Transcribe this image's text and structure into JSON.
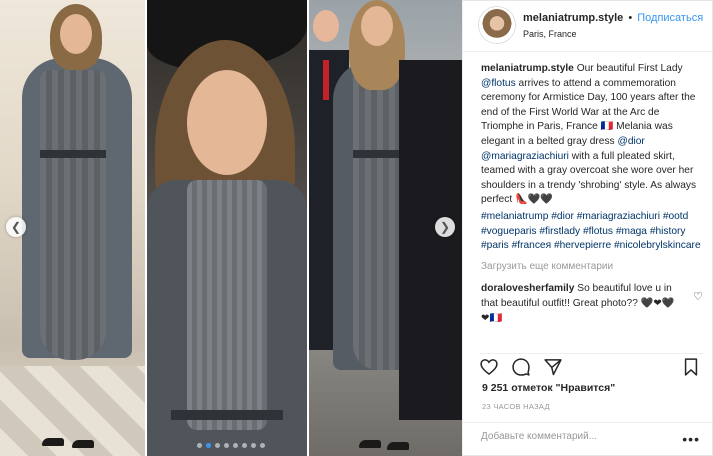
{
  "header": {
    "username": "melaniatrump.style",
    "separator": "•",
    "follow_label": "Подписаться",
    "location": "Paris, France"
  },
  "caption": {
    "username": "melaniatrump.style",
    "text_1": " Our beautiful First Lady ",
    "mention_1": "@flotus",
    "text_2": " arrives to attend a commemoration ceremony for Armistice Day, 100 years after the end of the First World War at the Arc de Triomphe in Paris, France 🇫🇷 Melania was elegant in a belted gray dress ",
    "mention_2": "@dior",
    "text_3": " ",
    "mention_3": "@mariagraziachiuri",
    "text_4": " with a full pleated skirt, teamed with a gray overcoat she wore over her shoulders in a trendy 'shrobing' style. As always perfect 👠🖤🖤"
  },
  "hashtags": [
    "#melaniatrump",
    "#dior",
    "#mariagraziachiuri",
    "#ootd",
    "#vogueparis",
    "#firstlady",
    "#flotus",
    "#maga",
    "#history",
    "#paris",
    "#franceя",
    "#hervepierre",
    "#nicolebrylskincare"
  ],
  "load_more_label": "Загрузить еще комментарии",
  "comment": {
    "username": "doralovesherfamily",
    "text": " So beautiful love u in that beautiful outfit!! Great photo?? 🖤❤🖤❤🇫🇷"
  },
  "likes": "9 251 отметок \"Нравится\"",
  "time": "23 ЧАСОВ НАЗАД",
  "add_comment_placeholder": "Добавьте комментарий...",
  "more_label": "•••",
  "icons": [
    "heart-icon",
    "comment-icon",
    "share-icon",
    "bookmark-icon",
    "chevron-left-icon",
    "chevron-right-icon",
    "more-icon"
  ],
  "carousel": {
    "dots": 8,
    "active_dot": 1
  },
  "colors": {
    "link": "#3897f0",
    "tag": "#003569",
    "muted": "#999999",
    "active_dot": "#3897f0"
  }
}
